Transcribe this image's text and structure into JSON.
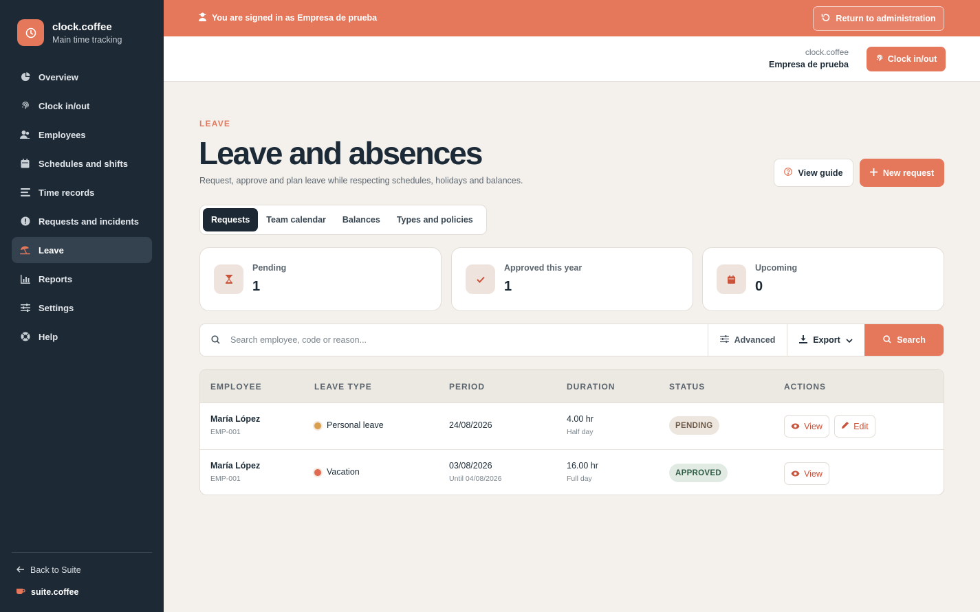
{
  "colors": {
    "accent": "#e5775b",
    "sidebar": "#1d2a36",
    "background": "#f4f1ec"
  },
  "brand": {
    "name": "clock.coffee",
    "subtitle": "Main time tracking",
    "icon": "clock-icon"
  },
  "sidebar": {
    "items": [
      {
        "label": "Overview",
        "icon": "pie-chart-icon"
      },
      {
        "label": "Clock in/out",
        "icon": "fingerprint-icon"
      },
      {
        "label": "Employees",
        "icon": "users-icon"
      },
      {
        "label": "Schedules and shifts",
        "icon": "calendar-icon"
      },
      {
        "label": "Time records",
        "icon": "list-icon"
      },
      {
        "label": "Requests and incidents",
        "icon": "alert-circle-icon"
      },
      {
        "label": "Leave",
        "icon": "umbrella-beach-icon",
        "active": true
      },
      {
        "label": "Reports",
        "icon": "bar-chart-icon"
      },
      {
        "label": "Settings",
        "icon": "sliders-icon"
      },
      {
        "label": "Help",
        "icon": "lifebuoy-icon"
      }
    ],
    "back_label": "Back to Suite",
    "suite_label": "suite.coffee"
  },
  "banner": {
    "text": "You are signed in as Empresa de prueba",
    "return_label": "Return to administration"
  },
  "topbar": {
    "app": "clock.coffee",
    "company": "Empresa de prueba",
    "clock_label": "Clock in/out"
  },
  "page": {
    "eyebrow": "LEAVE",
    "title": "Leave and absences",
    "description": "Request, approve and plan leave while respecting schedules, holidays and balances.",
    "guide_label": "View guide",
    "new_label": "New request"
  },
  "tabs": [
    {
      "label": "Requests",
      "active": true
    },
    {
      "label": "Team calendar"
    },
    {
      "label": "Balances"
    },
    {
      "label": "Types and policies"
    }
  ],
  "stats": [
    {
      "label": "Pending",
      "value": "1",
      "icon": "hourglass-icon"
    },
    {
      "label": "Approved this year",
      "value": "1",
      "icon": "check-icon"
    },
    {
      "label": "Upcoming",
      "value": "0",
      "icon": "calendar-icon"
    }
  ],
  "search": {
    "placeholder": "Search employee, code or reason...",
    "value": "",
    "advanced_label": "Advanced",
    "export_label": "Export",
    "search_label": "Search"
  },
  "table": {
    "columns": [
      "EMPLOYEE",
      "LEAVE TYPE",
      "PERIOD",
      "DURATION",
      "STATUS",
      "ACTIONS"
    ],
    "rows": [
      {
        "name": "María López",
        "code": "EMP-001",
        "type": "Personal leave",
        "type_color": "#d8a04e",
        "period": "24/08/2026",
        "period_sub": "",
        "duration": "4.00 hr",
        "duration_sub": "Half day",
        "status": "PENDING",
        "view_label": "View",
        "edit_label": "Edit"
      },
      {
        "name": "María López",
        "code": "EMP-001",
        "type": "Vacation",
        "type_color": "#e06a52",
        "period": "03/08/2026",
        "period_sub": "Until 04/08/2026",
        "duration": "16.00 hr",
        "duration_sub": "Full day",
        "status": "APPROVED",
        "view_label": "View"
      }
    ]
  }
}
